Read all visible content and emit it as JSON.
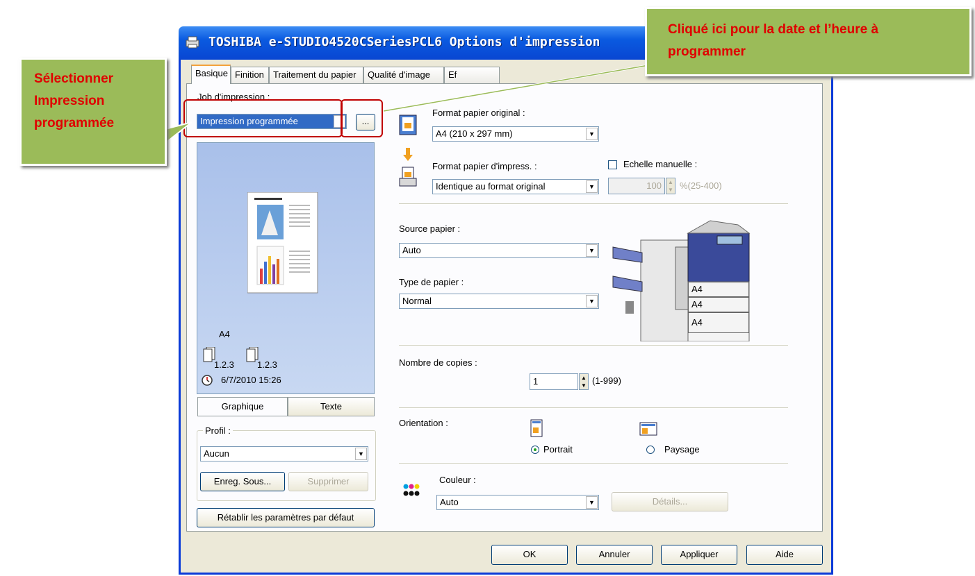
{
  "window": {
    "title": "TOSHIBA e-STUDIO4520CSeriesPCL6 Options d'impression"
  },
  "tabs": [
    "Basique",
    "Finition",
    "Traitement du papier",
    "Qualité d'image",
    "Ef"
  ],
  "job": {
    "label": "Job d'impression :",
    "value": "Impression programmée",
    "browse_label": "..."
  },
  "preview": {
    "paper": "A4",
    "collate_a": "1.2.3",
    "collate_b": "1.2.3",
    "datetime": "6/7/2010 15:26",
    "view_tabs": [
      "Graphique",
      "Texte"
    ]
  },
  "profile": {
    "label": "Profil :",
    "value": "Aucun",
    "save_label": "Enreg. Sous...",
    "delete_label": "Supprimer",
    "reset_label": "Rétablir les paramètres par défaut"
  },
  "paper": {
    "original_label": "Format papier original :",
    "original_value": "A4 (210 x 297 mm)",
    "print_label": "Format papier d'impress. :",
    "print_value": "Identique au format original",
    "manual_scale_label": "Echelle manuelle :",
    "scale_value": "100",
    "scale_range": "%(25-400)"
  },
  "source": {
    "label": "Source papier :",
    "value": "Auto"
  },
  "type": {
    "label": "Type de papier :",
    "value": "Normal"
  },
  "copier_trays": [
    "A4",
    "A4",
    "A4"
  ],
  "copies": {
    "label": "Nombre de copies :",
    "value": "1",
    "range": "(1-999)"
  },
  "orientation": {
    "label": "Orientation :",
    "portrait": "Portrait",
    "landscape": "Paysage",
    "selected": "Portrait"
  },
  "color": {
    "label": "Couleur :",
    "value": "Auto",
    "details_label": "Détails..."
  },
  "footer": {
    "ok": "OK",
    "cancel": "Annuler",
    "apply": "Appliquer",
    "help": "Aide"
  },
  "callouts": {
    "left": "Sélectionner Impression programmée",
    "right": "Cliqué ici pour la date et l’heure à programmer"
  },
  "colors": {
    "callout_fill": "#9bbb59",
    "callout_text": "#e00000",
    "highlight": "#c00000",
    "xp_blue": "#0a5ae0"
  }
}
